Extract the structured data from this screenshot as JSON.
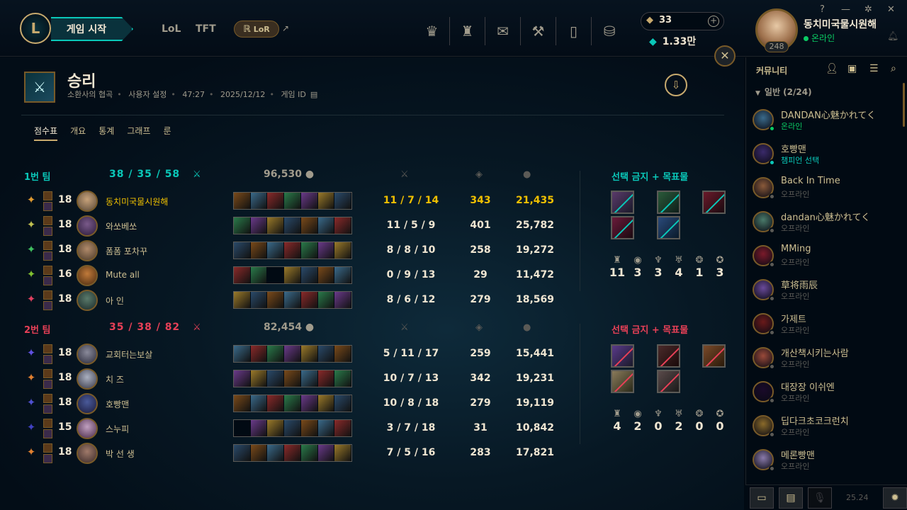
{
  "header": {
    "play_label": "게임 시작",
    "tabs": [
      "LoL",
      "TFT"
    ],
    "lor_label": "LoR",
    "external_icon": "↗",
    "nav_icons": [
      "clash-icon",
      "champions-icon",
      "loot-icon",
      "crafting-icon",
      "collection-icon",
      "store-icon"
    ],
    "rp": "33",
    "be": "1.33만",
    "profile": {
      "name": "동치미국물시원해",
      "status": "온라인",
      "level": "248"
    }
  },
  "match": {
    "result": "승리",
    "meta": [
      "소환사의 협곡",
      "사용자 설정",
      "47:27",
      "2025/12/12",
      "게임 ID"
    ],
    "tabs": [
      "점수표",
      "개요",
      "통계",
      "그래프",
      "룬"
    ],
    "team1": {
      "name": "1번 팀",
      "kda": "38 / 35 / 58",
      "gold": "96,530",
      "ban_label": "선택 금지 + 목표물",
      "objectives": [
        "11",
        "3",
        "3",
        "4",
        "1",
        "3"
      ],
      "players": [
        {
          "level": "18",
          "name": "동치미국물시원해",
          "kda": "11 / 7 / 14",
          "cs": "343",
          "gold": "21,435",
          "me": true
        },
        {
          "level": "18",
          "name": "와쏘베쏘",
          "kda": "11 / 5 / 9",
          "cs": "401",
          "gold": "25,782"
        },
        {
          "level": "18",
          "name": "폼폼 포차꾸",
          "kda": "8 / 8 / 10",
          "cs": "258",
          "gold": "19,272"
        },
        {
          "level": "16",
          "name": "Mute all",
          "kda": "0 / 9 / 13",
          "cs": "29",
          "gold": "11,472"
        },
        {
          "level": "18",
          "name": "아 인",
          "kda": "8 / 6 / 12",
          "cs": "279",
          "gold": "18,569"
        }
      ]
    },
    "team2": {
      "name": "2번 팀",
      "kda": "35 / 38 / 82",
      "gold": "82,454",
      "ban_label": "선택 금지 + 목표물",
      "objectives": [
        "4",
        "2",
        "0",
        "2",
        "0",
        "0"
      ],
      "players": [
        {
          "level": "18",
          "name": "교회터는보살",
          "kda": "5 / 11 / 17",
          "cs": "259",
          "gold": "15,441"
        },
        {
          "level": "18",
          "name": "치 즈",
          "kda": "10 / 7 / 13",
          "cs": "342",
          "gold": "19,231"
        },
        {
          "level": "18",
          "name": "호빵맨",
          "kda": "10 / 8 / 18",
          "cs": "279",
          "gold": "19,119"
        },
        {
          "level": "15",
          "name": "스누피",
          "kda": "3 / 7 / 18",
          "cs": "31",
          "gold": "10,842"
        },
        {
          "level": "18",
          "name": "박 선 생",
          "kda": "7 / 5 / 16",
          "cs": "283",
          "gold": "17,821"
        }
      ]
    }
  },
  "social": {
    "title": "커뮤니티",
    "group": "일반 (2/24)",
    "friends": [
      {
        "name": "DANDAN心魅かれてく",
        "status": "온라인",
        "color": "#0acb64"
      },
      {
        "name": "호빵맨",
        "status": "챔피언 선택",
        "color": "#0ac8b9"
      },
      {
        "name": "Back In Time",
        "status": "오프라인",
        "color": "#5b5a56"
      },
      {
        "name": "dandan心魅かれてく",
        "status": "오프라인",
        "color": "#5b5a56"
      },
      {
        "name": "MMing",
        "status": "오프라인",
        "color": "#5b5a56"
      },
      {
        "name": "草将雨辰",
        "status": "오프라인",
        "color": "#5b5a56"
      },
      {
        "name": "가제트",
        "status": "오프라인",
        "color": "#5b5a56"
      },
      {
        "name": "개산책시키는사람",
        "status": "오프라인",
        "color": "#5b5a56"
      },
      {
        "name": "대장장 이쉬엔",
        "status": "오프라인",
        "color": "#5b5a56"
      },
      {
        "name": "딥다크초코크런치",
        "status": "오프라인",
        "color": "#5b5a56"
      },
      {
        "name": "메론빵맨",
        "status": "오프라인",
        "color": "#5b5a56"
      }
    ],
    "version": "25.24"
  },
  "colors": {
    "gold": "#c8aa6e",
    "blue_team": "#0ac8b9",
    "red_team": "#e84057",
    "self": "#f0c000"
  }
}
